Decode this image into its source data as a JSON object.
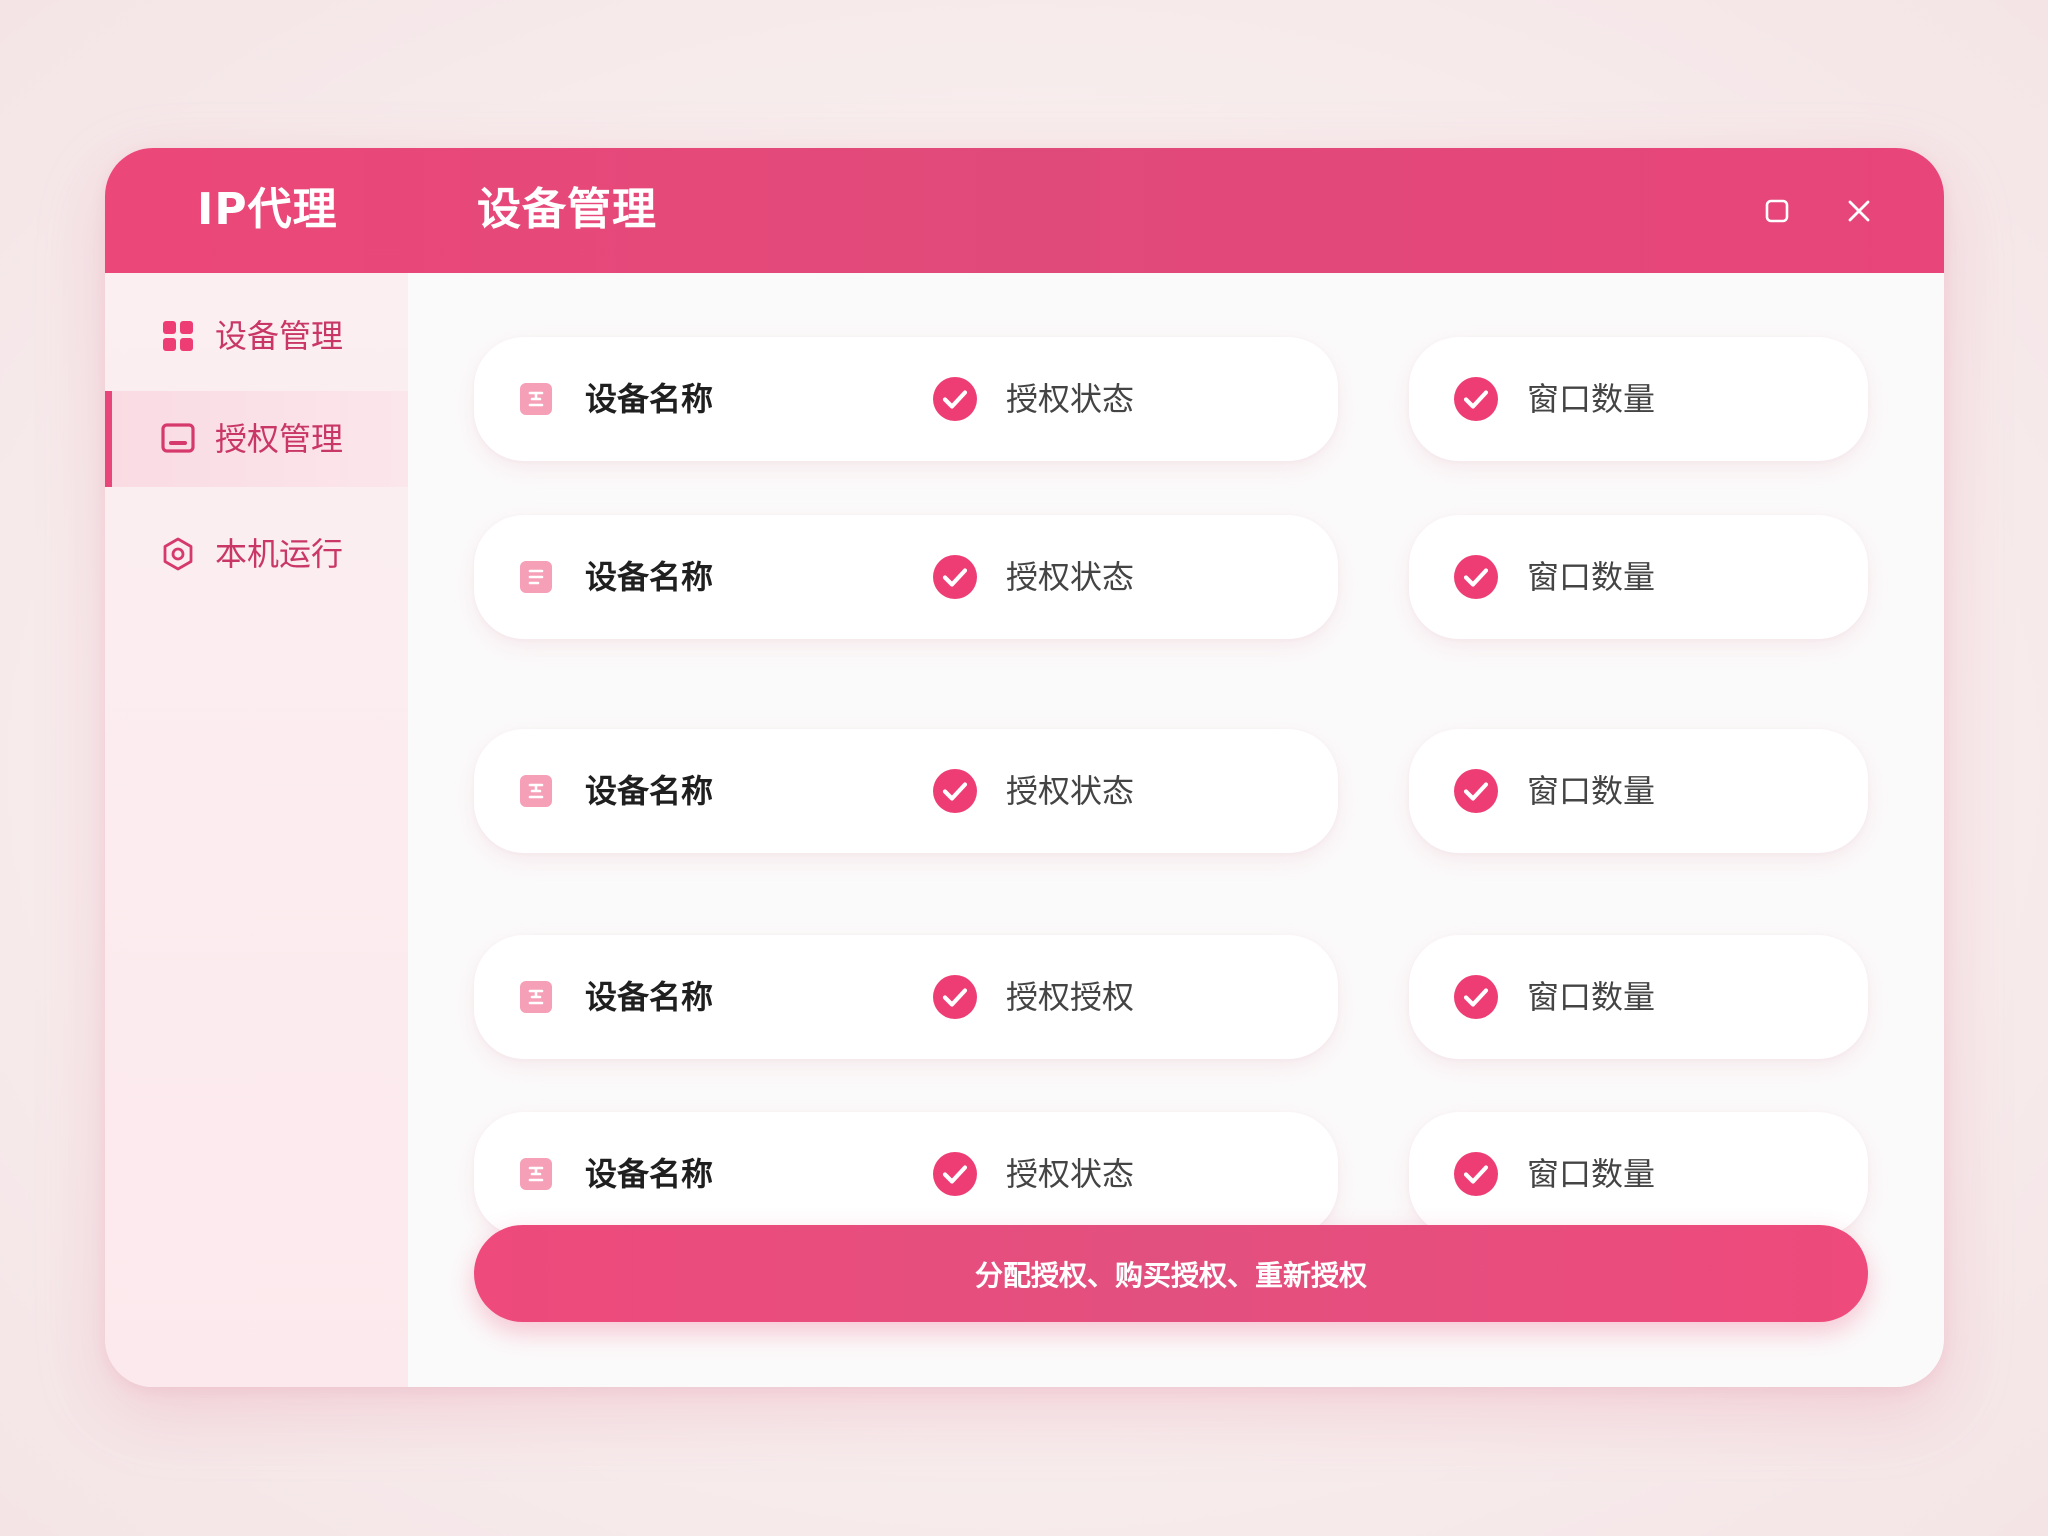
{
  "window": {
    "app_title": "IP代理",
    "page_title": "设备管理",
    "maximize_icon": "maximize-icon",
    "close_icon": "close-icon"
  },
  "sidebar": {
    "items": [
      {
        "label": "设备管理",
        "icon": "grid-icon",
        "active": false
      },
      {
        "label": "授权管理",
        "icon": "monitor-icon",
        "active": true
      },
      {
        "label": "本机运行",
        "icon": "hexagon-icon",
        "active": false
      }
    ]
  },
  "devices": [
    {
      "name": "设备名称",
      "status": "授权状态",
      "windows": "窗口数量"
    },
    {
      "name": "设备名称",
      "status": "授权状态",
      "windows": "窗口数量"
    },
    {
      "name": "设备名称",
      "status": "授权状态",
      "windows": "窗口数量"
    },
    {
      "name": "设备名称",
      "status": "授权授权",
      "windows": "窗口数量"
    },
    {
      "name": "设备名称",
      "status": "授权状态",
      "windows": "窗口数量"
    }
  ],
  "action_button": {
    "label": "分配授权、购买授权、重新授权"
  },
  "colors": {
    "accent": "#e8457a",
    "accent_dark": "#c93767",
    "sidebar_bg": "#fbeff1",
    "card_bg": "#ffffff",
    "check_fill": "#ee3d74"
  }
}
